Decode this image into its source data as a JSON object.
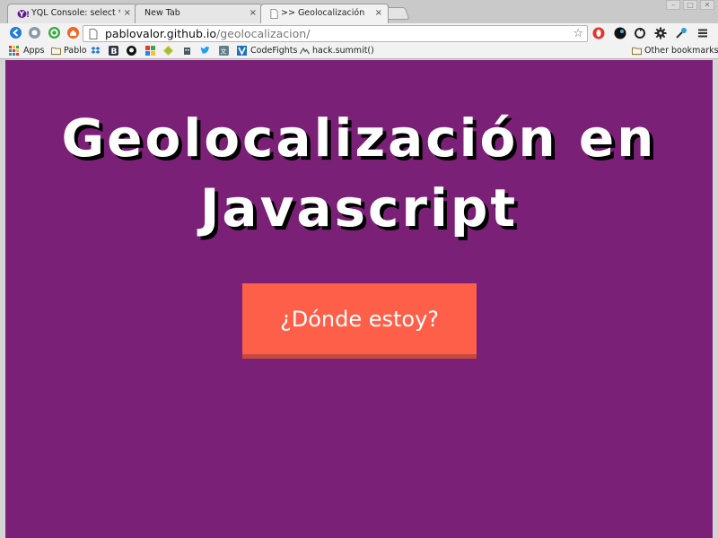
{
  "browser": {
    "tabs": [
      {
        "title": "YQL Console: select * fro",
        "favicon": "yahoo-icon",
        "active": false
      },
      {
        "title": "New Tab",
        "favicon": "",
        "active": false
      },
      {
        "title": ">> Geolocalización",
        "favicon": "page-icon",
        "active": true
      }
    ],
    "tab_close_glyph": "×",
    "url_host": "pablovalor.github.io",
    "url_path": "/geolocalizacion/",
    "bookmarks": [
      {
        "label": "Apps",
        "icon": "apps-grid-icon"
      },
      {
        "label": "Pablo",
        "icon": "folder-icon"
      },
      {
        "label": "",
        "icon": "dropbox-icon"
      },
      {
        "label": "",
        "icon": "b-icon"
      },
      {
        "label": "",
        "icon": "github-icon"
      },
      {
        "label": "",
        "icon": "color-squares-icon"
      },
      {
        "label": "",
        "icon": "puzzle-icon"
      },
      {
        "label": "",
        "icon": "robot-icon"
      },
      {
        "label": "",
        "icon": "twitter-icon"
      },
      {
        "label": "",
        "icon": "translate-icon"
      },
      {
        "label": "CodeFights",
        "icon": "codefights-icon"
      },
      {
        "label": "hack.summit()",
        "icon": "hack-summit-icon"
      }
    ],
    "other_bookmarks": "Other bookmarks"
  },
  "page": {
    "title_line1": "Geolocalización en",
    "title_line2": "Javascript",
    "button_label": "¿Dónde estoy?"
  },
  "colors": {
    "page_background": "#7b2077",
    "button_background": "#fe5f48",
    "button_border": "#c44a3c",
    "title_text": "#ffffff",
    "title_shadow": "#000000"
  }
}
